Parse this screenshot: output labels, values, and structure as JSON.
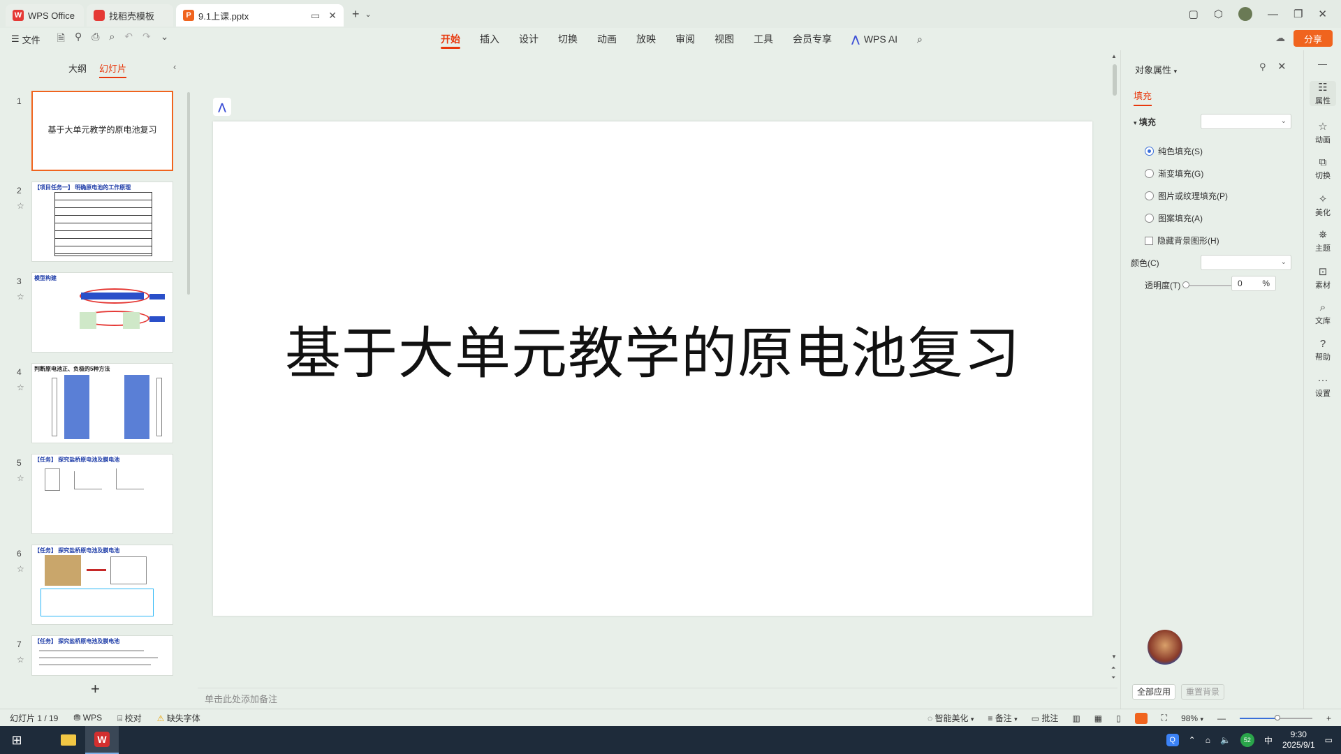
{
  "tabs": {
    "wps_office": "WPS Office",
    "find_template": "找稻壳模板",
    "active_file": "9.1上课.pptx"
  },
  "ribbon": {
    "file_menu": "文件",
    "menus": [
      "开始",
      "插入",
      "设计",
      "切换",
      "动画",
      "放映",
      "审阅",
      "视图",
      "工具",
      "会员专享",
      "WPS AI"
    ],
    "active_menu": "开始",
    "share": "分享"
  },
  "left_panel": {
    "tab_outline": "大纲",
    "tab_slides": "幻灯片",
    "slides": [
      {
        "num": "1",
        "text": "基于大单元教学的原电池复习"
      },
      {
        "num": "2",
        "text": "【项目任务一】 明确原电池的工作原理"
      },
      {
        "num": "3",
        "text": "模型构建"
      },
      {
        "num": "4",
        "text": "判断原电池正、负极的5种方法"
      },
      {
        "num": "5",
        "text": "【任务】 探究盐桥原电池及膜电池"
      },
      {
        "num": "6",
        "text": "【任务】 探究盐桥原电池及膜电池"
      },
      {
        "num": "7",
        "text": "【任务】 探究盐桥原电池及膜电池"
      }
    ],
    "add_slide": "+"
  },
  "slide": {
    "title": "基于大单元教学的原电池复习"
  },
  "notes": {
    "placeholder": "单击此处添加备注"
  },
  "right_panel": {
    "header": "对象属性",
    "fill_tab": "填充",
    "section": "填充",
    "options": [
      "纯色填充(S)",
      "渐变填充(G)",
      "图片或纹理填充(P)",
      "图案填充(A)"
    ],
    "hide_bg": "隐藏背景图形(H)",
    "color_label": "颜色(C)",
    "transparency_label": "透明度(T)",
    "transparency_value": "0",
    "percent": "%",
    "apply_all": "全部应用",
    "reset_bg": "重置背景"
  },
  "sidebar": {
    "items": [
      "属性",
      "动画",
      "切换",
      "美化",
      "主题",
      "素材",
      "文库",
      "帮助",
      "设置"
    ]
  },
  "status": {
    "slide_count": "幻灯片 1 / 19",
    "wps": "WPS",
    "proofread": "校对",
    "missing_font": "缺失字体",
    "smart_beautify": "智能美化",
    "notes": "备注",
    "comments": "批注",
    "zoom": "98%",
    "zoom_fraction": 0.49
  },
  "taskbar": {
    "time": "9:30",
    "date": "2025/9/1",
    "badge": "52"
  },
  "colors": {
    "accent": "#e8380d",
    "share": "#f0641e",
    "radio_on": "#3b6fd9"
  }
}
